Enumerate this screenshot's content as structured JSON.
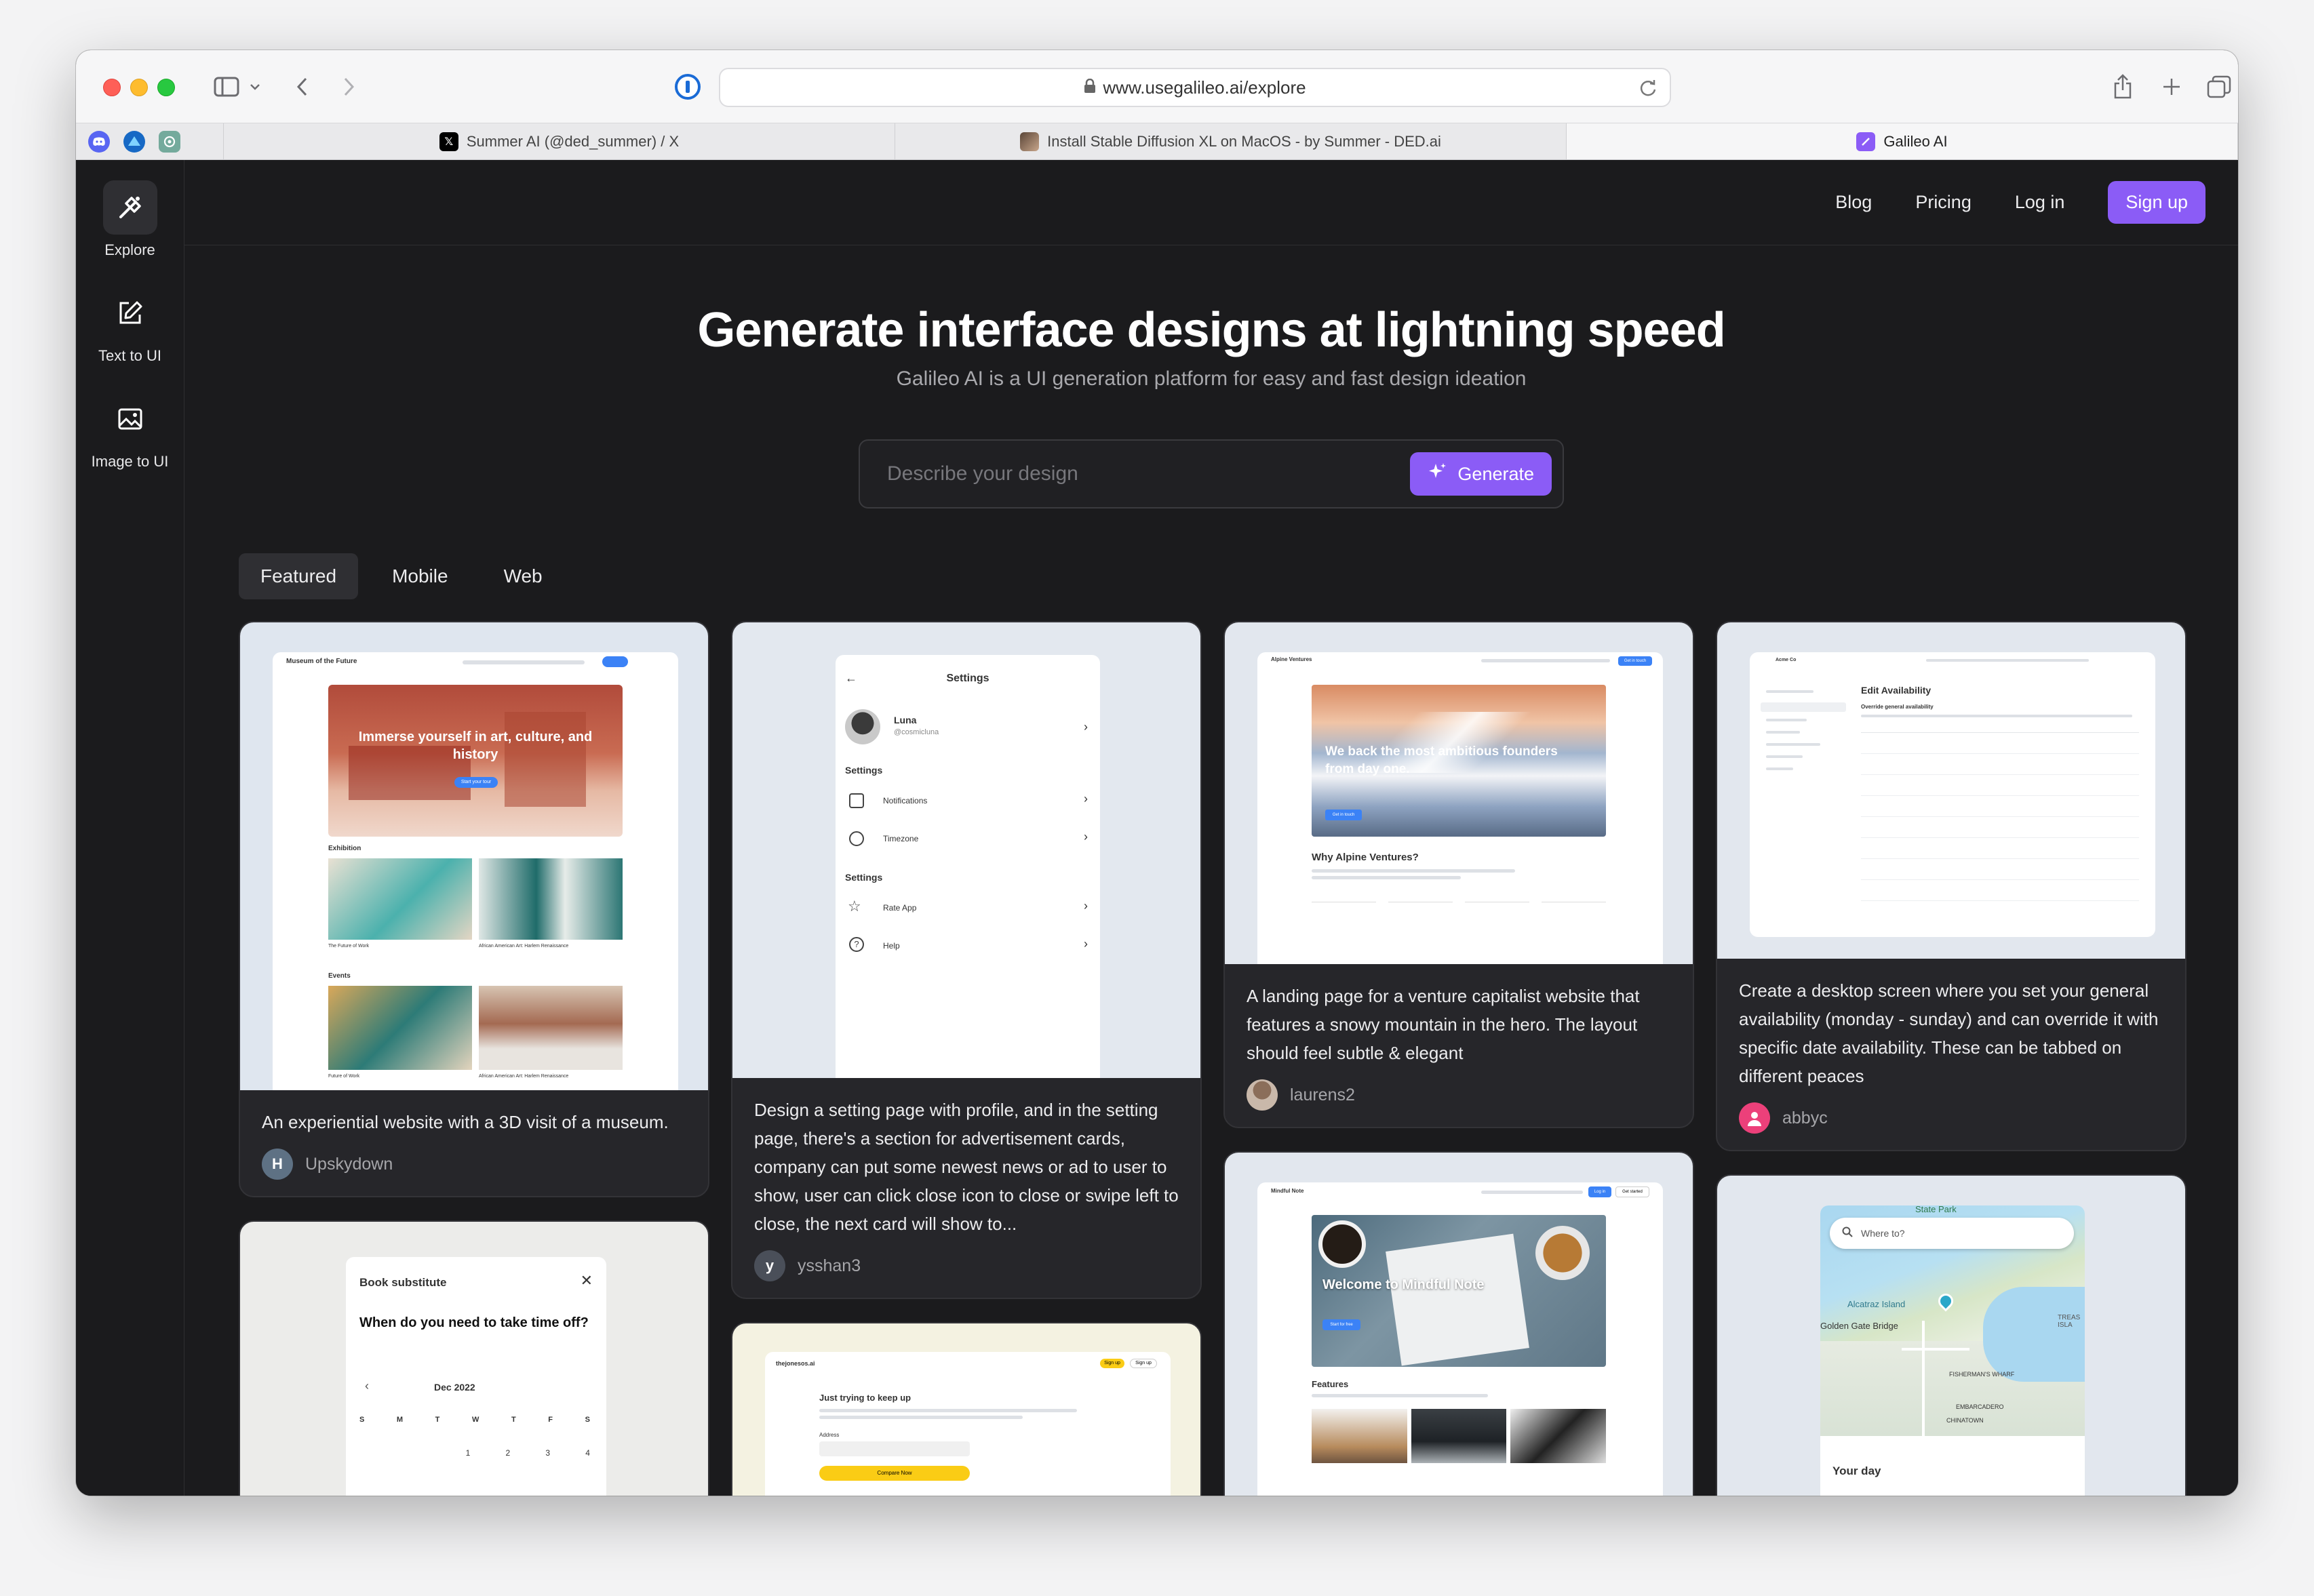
{
  "browser": {
    "url": "www.usegalileo.ai/explore",
    "tabs": [
      {
        "label": "Summer AI (@ded_summer) / X",
        "icon": "x-logo-icon"
      },
      {
        "label": "Install Stable Diffusion XL on MacOS - by Summer - DED.ai",
        "icon": "article-favicon-icon"
      },
      {
        "label": "Galileo AI",
        "icon": "galileo-favicon-icon"
      }
    ]
  },
  "sidebar": {
    "items": [
      {
        "label": "Explore",
        "icon": "explore-icon"
      },
      {
        "label": "Text to UI",
        "icon": "edit-icon"
      },
      {
        "label": "Image to UI",
        "icon": "image-icon"
      }
    ]
  },
  "nav": {
    "blog": "Blog",
    "pricing": "Pricing",
    "login": "Log in",
    "signup": "Sign up"
  },
  "hero": {
    "title": "Generate interface designs at lightning speed",
    "subtitle": "Galileo AI is a UI generation platform for easy and fast design ideation",
    "placeholder": "Describe your design",
    "generate": "Generate"
  },
  "filters": [
    "Featured",
    "Mobile",
    "Web"
  ],
  "cards": [
    {
      "desc": "An experiential website with a 3D visit of a museum.",
      "author": "Upskydown",
      "initial": "H"
    },
    {
      "desc": "Design a setting page with profile, and in the setting page, there's a section for advertisement cards, company can put some newest news or ad to user to show,  user can click close icon to close or swipe left to close, the next card will show to...",
      "author": "ysshan3",
      "initial": "y"
    },
    {
      "desc": "A landing page for a venture capitalist website that features a snowy mountain in the hero. The layout should feel subtle & elegant",
      "author": "laurens2"
    },
    {
      "desc": "Create a desktop screen where you set your general availability (monday - sunday) and can override it with specific date availability. These can be tabbed on different peaces",
      "author": "abbyc"
    }
  ],
  "previews": {
    "museum": {
      "brand": "Museum of the Future",
      "hero": "Immerse yourself in art, culture, and history",
      "exhibition": "Exhibition",
      "events": "Events",
      "cta": "Start your tour",
      "caption1": "The Future of Work",
      "caption2": "African American Art: Harlem Renaissance",
      "caption3": "Future of Work",
      "caption4": "African American Art: Harlem Renaissance"
    },
    "settings": {
      "title": "Settings",
      "name": "Luna",
      "handle": "@cosmicluna",
      "section1": "Settings",
      "item1": "Notifications",
      "item2": "Timezone",
      "section2": "Settings",
      "item3": "Rate App",
      "item4": "Help"
    },
    "alpine": {
      "brand": "Alpine Ventures",
      "hero": "We back the most ambitious founders from day one.",
      "why": "Why Alpine Ventures?",
      "cta": "Get in touch",
      "btn": "Get in touch"
    },
    "availability": {
      "brand": "Acme Co",
      "title": "Edit Availability",
      "override": "Override general availability"
    },
    "booking": {
      "title": "Book substitute",
      "question": "When do you need to take time off?",
      "month": "Dec 2022",
      "days": [
        "S",
        "M",
        "T",
        "W",
        "T",
        "F",
        "S"
      ],
      "dates": [
        "1",
        "2",
        "3",
        "4"
      ]
    },
    "lenses": {
      "brand": "thejonesos.ai",
      "heading": "Just trying to keep up",
      "field": "Address",
      "btn": "Compare Now",
      "btn_small": "Sign up",
      "btn_small2": "Sign up"
    },
    "mindful": {
      "brand": "Mindful Note",
      "hero": "Welcome to Mindful Note",
      "features": "Features",
      "cta": "Start for free",
      "nav_btn": "Log in",
      "nav_btn2": "Get started"
    },
    "map": {
      "search": "Where to?",
      "label1": "State Park",
      "label2": "Alcatraz Island",
      "label3": "Golden Gate Bridge",
      "label4": "FISHERMAN'S WHARF",
      "label5": "EMBARCADERO",
      "label6": "CHINATOWN",
      "label7": "TREAS ISLA",
      "footer": "Your day"
    }
  }
}
